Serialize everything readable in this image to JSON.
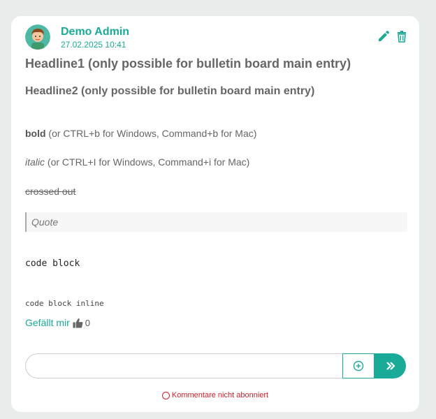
{
  "post": {
    "author": "Demo Admin",
    "date": "27.02.2025 10:41",
    "headline1": "Headline1 (only possible for bulletin board main entry)",
    "headline2": "Headline2 (only possible for bulletin board main entry)",
    "bold_word": "bold",
    "bold_rest": " (or CTRL+b for Windows, Command+b for Mac)",
    "italic_word": "italic",
    "italic_rest": " (or CTRL+I for Windows, Command+i for Mac)",
    "crossed": "crossed out",
    "quote": "Quote",
    "code_block": "code block",
    "code_inline": "code block inline"
  },
  "icons": {
    "edit": "pencil-icon",
    "delete": "trash-icon",
    "like": "thumbs-up-icon",
    "add": "plus-circle-icon",
    "send": "double-chevron-right-icon"
  },
  "like": {
    "label": "Gefällt mir",
    "count": "0"
  },
  "comment": {
    "placeholder": "",
    "subscription": "Kommentare nicht abonniert"
  },
  "colors": {
    "accent": "#1aaa98",
    "warning": "#d0202b",
    "text": "#666666"
  }
}
